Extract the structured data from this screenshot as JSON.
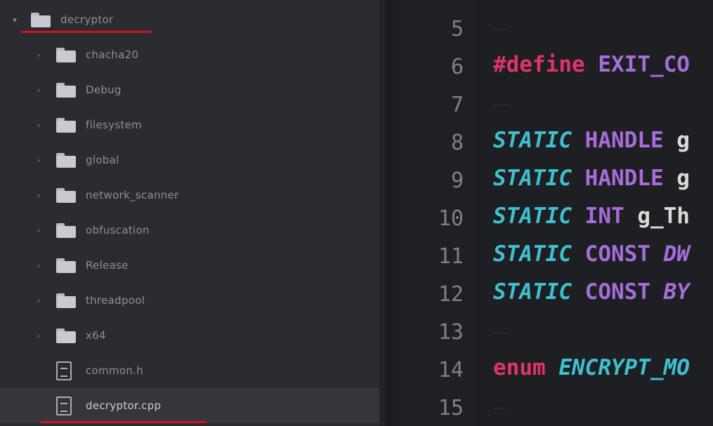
{
  "explorer": {
    "items": [
      {
        "label": "decryptor",
        "type": "folder",
        "expanded": true,
        "depth": 0
      },
      {
        "label": "chacha20",
        "type": "folder",
        "expanded": false,
        "depth": 1
      },
      {
        "label": "Debug",
        "type": "folder",
        "expanded": false,
        "depth": 1
      },
      {
        "label": "filesystem",
        "type": "folder",
        "expanded": false,
        "depth": 1
      },
      {
        "label": "global",
        "type": "folder",
        "expanded": false,
        "depth": 1
      },
      {
        "label": "network_scanner",
        "type": "folder",
        "expanded": false,
        "depth": 1
      },
      {
        "label": "obfuscation",
        "type": "folder",
        "expanded": false,
        "depth": 1
      },
      {
        "label": "Release",
        "type": "folder",
        "expanded": false,
        "depth": 1
      },
      {
        "label": "threadpool",
        "type": "folder",
        "expanded": false,
        "depth": 1
      },
      {
        "label": "x64",
        "type": "folder",
        "expanded": false,
        "depth": 1
      },
      {
        "label": "common.h",
        "type": "file",
        "depth": 1
      },
      {
        "label": "decryptor.cpp",
        "type": "file",
        "depth": 1,
        "selected": true
      }
    ],
    "icons": {
      "folder": "folder-icon",
      "file": "file-icon",
      "expanded": "chevron-down-icon",
      "collapsed": "chevron-right-icon"
    },
    "highlight_color": "#d4121c"
  },
  "editor": {
    "lines": [
      {
        "number": "5",
        "tokens": []
      },
      {
        "number": "6",
        "tokens": [
          {
            "t": "#define",
            "c": "pre"
          },
          {
            "t": " ",
            "c": "ident"
          },
          {
            "t": "EXIT_CO",
            "c": "macro"
          }
        ]
      },
      {
        "number": "7",
        "tokens": []
      },
      {
        "number": "8",
        "tokens": [
          {
            "t": "STATIC",
            "c": "kw"
          },
          {
            "t": " ",
            "c": "ident"
          },
          {
            "t": "HANDLE",
            "c": "type"
          },
          {
            "t": " g",
            "c": "ident"
          }
        ]
      },
      {
        "number": "9",
        "tokens": [
          {
            "t": "STATIC",
            "c": "kw"
          },
          {
            "t": " ",
            "c": "ident"
          },
          {
            "t": "HANDLE",
            "c": "type"
          },
          {
            "t": " g",
            "c": "ident"
          }
        ]
      },
      {
        "number": "10",
        "tokens": [
          {
            "t": "STATIC",
            "c": "kw"
          },
          {
            "t": " ",
            "c": "ident"
          },
          {
            "t": "INT",
            "c": "type"
          },
          {
            "t": " g_Th",
            "c": "ident"
          }
        ]
      },
      {
        "number": "11",
        "tokens": [
          {
            "t": "STATIC",
            "c": "kw"
          },
          {
            "t": " ",
            "c": "ident"
          },
          {
            "t": "CONST",
            "c": "type"
          },
          {
            "t": " DW",
            "c": "type-it"
          }
        ]
      },
      {
        "number": "12",
        "tokens": [
          {
            "t": "STATIC",
            "c": "kw"
          },
          {
            "t": " ",
            "c": "ident"
          },
          {
            "t": "CONST",
            "c": "type"
          },
          {
            "t": " BY",
            "c": "type-it"
          }
        ]
      },
      {
        "number": "13",
        "tokens": []
      },
      {
        "number": "14",
        "tokens": [
          {
            "t": "enum",
            "c": "enum"
          },
          {
            "t": " ",
            "c": "ident"
          },
          {
            "t": "ENCRYPT_MO",
            "c": "enumname"
          }
        ]
      },
      {
        "number": "15",
        "tokens": []
      }
    ],
    "colors": {
      "preprocessor": "#e0336e",
      "macro": "#a66ddb",
      "keyword": "#3fc0d0",
      "type": "#a66ddb",
      "identifier": "#d9dadc"
    }
  }
}
